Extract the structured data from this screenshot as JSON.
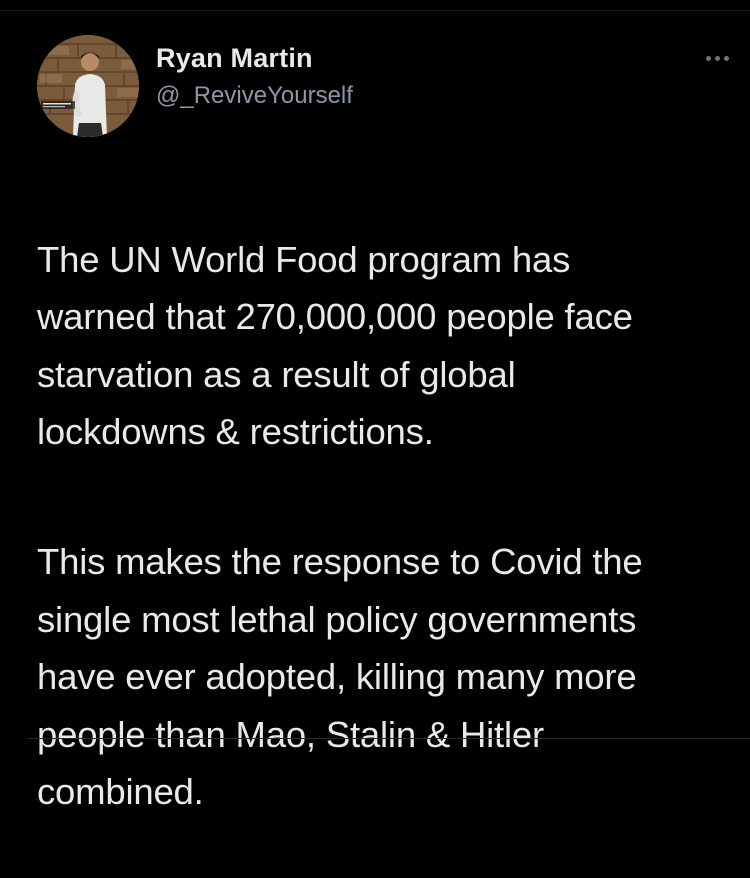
{
  "tweet": {
    "author": {
      "name": "Ryan Martin",
      "handle": "@_ReviveYourself",
      "avatar_icon": "profile-photo-avatar"
    },
    "more_icon": "more-options-icon",
    "paragraphs": [
      "The UN World Food program has\nwarned that 270,000,000 people face\nstarvation as a result of global\nlockdowns & restrictions.",
      "This makes the response to Covid the\nsingle most lethal policy governments\nhave ever adopted, killing many more\npeople than Mao, Stalin & Hitler\ncombined."
    ]
  },
  "colors": {
    "background": "#000000",
    "primary_text": "#e7e9ea",
    "secondary_text": "#8b98a5",
    "icon": "#6e767d"
  }
}
